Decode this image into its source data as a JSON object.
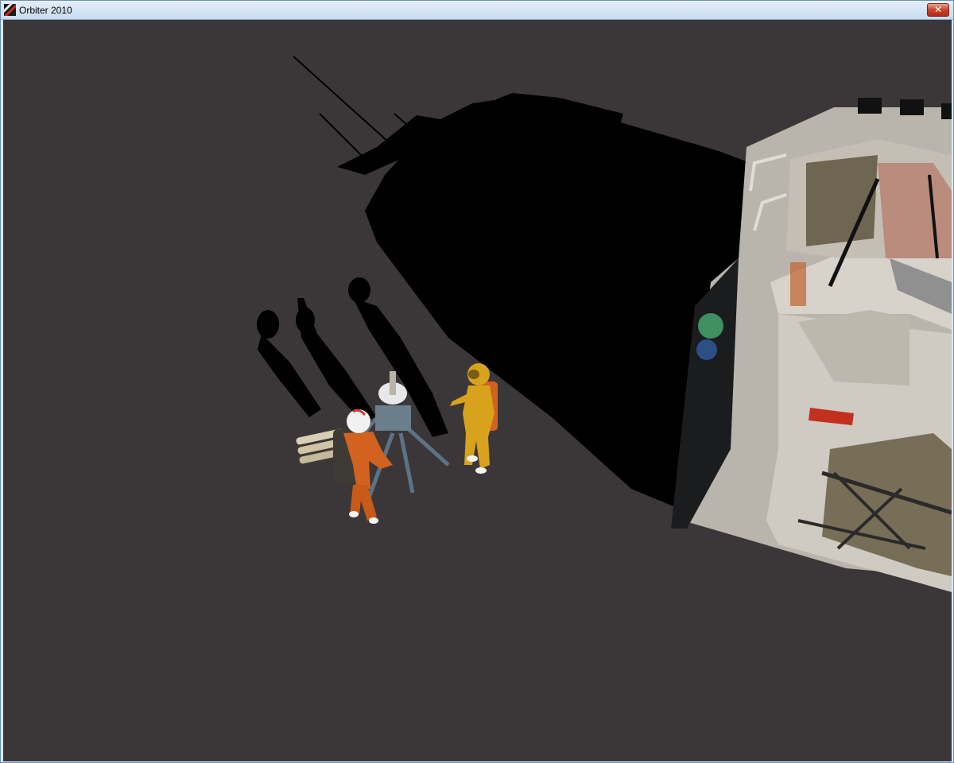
{
  "window": {
    "title": "Orbiter 2010",
    "close_symbol": "✕",
    "app_icon": "orbiter-app-icon"
  },
  "scene": {
    "description_icons": [
      "astronaut-orange-figure",
      "astronaut-yellow-figure",
      "drill-rig-figure",
      "lander-vehicle-figure"
    ],
    "colors": {
      "ground": "#3b3738",
      "shadow": "#000000",
      "orange_suit": "#d2621f",
      "yellow_suit": "#d9a21d",
      "vehicle_hull": "#c9c5bd"
    }
  }
}
